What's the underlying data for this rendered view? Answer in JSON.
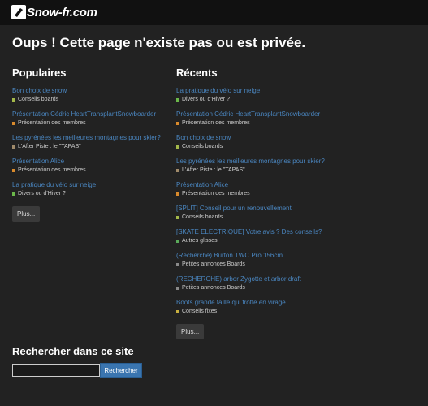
{
  "header": {
    "logo_text": "Snow-fr.com"
  },
  "page_title": "Oups ! Cette page n'existe pas ou est privée.",
  "popular": {
    "heading": "Populaires",
    "items": [
      {
        "title": "Bon choix de snow",
        "category": "Conseils boards",
        "color": "#a3b84a"
      },
      {
        "title": "Présentation Cédric HeartTransplantSnowboarder",
        "category": "Présentation des membres",
        "color": "#d98a2c"
      },
      {
        "title": "Les pyrénées les meilleures montagnes pour skier?",
        "category": "L'After Piste : le \"TAPAS\"",
        "color": "#a08a6a"
      },
      {
        "title": "Présentation Alice",
        "category": "Présentation des membres",
        "color": "#d98a2c"
      },
      {
        "title": "La pratique du vélo sur neige",
        "category": "Divers ou d'Hiver ?",
        "color": "#6bb84a"
      }
    ],
    "more_label": "Plus..."
  },
  "recent": {
    "heading": "Récents",
    "items": [
      {
        "title": "La pratique du vélo sur neige",
        "category": "Divers ou d'Hiver ?",
        "color": "#6bb84a"
      },
      {
        "title": "Présentation Cédric HeartTransplantSnowboarder",
        "category": "Présentation des membres",
        "color": "#d98a2c"
      },
      {
        "title": "Bon choix de snow",
        "category": "Conseils boards",
        "color": "#a3b84a"
      },
      {
        "title": "Les pyrénées les meilleures montagnes pour skier?",
        "category": "L'After Piste : le \"TAPAS\"",
        "color": "#a08a6a"
      },
      {
        "title": "Présentation Alice",
        "category": "Présentation des membres",
        "color": "#d98a2c"
      },
      {
        "title": "[SPLIT] Conseil pour un renouvellement",
        "category": "Conseils boards",
        "color": "#a3b84a"
      },
      {
        "title": "[SKATE ELECTRIQUE] Votre avis ? Des conseils?",
        "category": "Autres glisses",
        "color": "#5aaa5a"
      },
      {
        "title": "(Recherche) Burton TWC Pro 156cm",
        "category": "Petites annonces Boards",
        "color": "#8a8a8a"
      },
      {
        "title": "(RECHERCHE) arbor Zygotte et arbor draft",
        "category": "Petites annonces Boards",
        "color": "#8a8a8a"
      },
      {
        "title": "Boots grande taille qui frotte en virage",
        "category": "Conseils fixes",
        "color": "#c8b040"
      }
    ],
    "more_label": "Plus..."
  },
  "search": {
    "heading": "Rechercher dans ce site",
    "input_value": "",
    "button_label": "Rechercher"
  }
}
